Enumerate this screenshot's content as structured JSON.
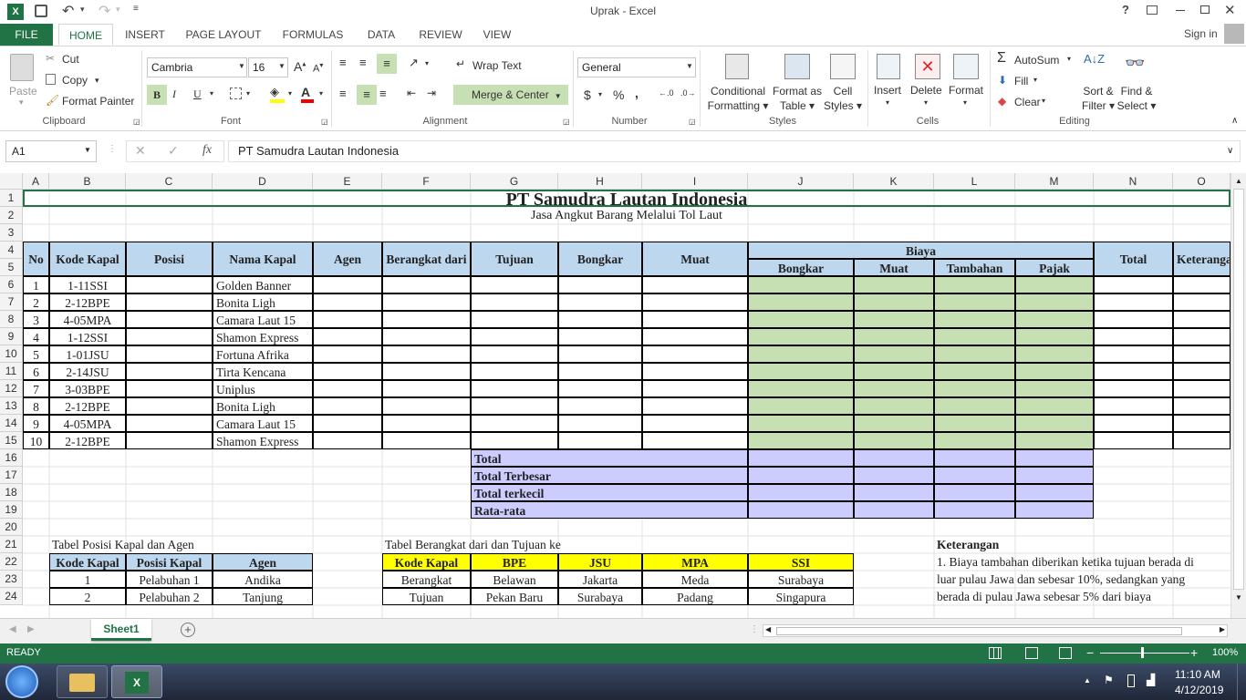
{
  "window": {
    "title": "Uprak - Excel",
    "help": "?",
    "sign_in": "Sign in"
  },
  "tabs": [
    "FILE",
    "HOME",
    "INSERT",
    "PAGE LAYOUT",
    "FORMULAS",
    "DATA",
    "REVIEW",
    "VIEW"
  ],
  "ribbon": {
    "clipboard": {
      "paste": "Paste",
      "cut": "Cut",
      "copy": "Copy",
      "format_painter": "Format Painter",
      "label": "Clipboard"
    },
    "font": {
      "name": "Cambria",
      "size": "16",
      "label": "Font",
      "bold": "B",
      "italic": "I",
      "underline": "U"
    },
    "alignment": {
      "wrap": "Wrap Text",
      "merge": "Merge & Center",
      "label": "Alignment"
    },
    "number": {
      "format": "General",
      "currency": "$",
      "percent": "%",
      "comma": ",",
      "label": "Number"
    },
    "styles": {
      "conditional": "Conditional",
      "conditional2": "Formatting",
      "format_as": "Format as",
      "format_as2": "Table",
      "cell": "Cell",
      "cell2": "Styles",
      "label": "Styles"
    },
    "cells": {
      "insert": "Insert",
      "delete": "Delete",
      "format": "Format",
      "label": "Cells"
    },
    "editing": {
      "autosum": "AutoSum",
      "fill": "Fill",
      "clear": "Clear",
      "sort": "Sort &",
      "sort2": "Filter",
      "find": "Find &",
      "find2": "Select",
      "label": "Editing"
    }
  },
  "formula_bar": {
    "name_box": "A1",
    "fx": "fx",
    "content": "PT Samudra Lautan Indonesia"
  },
  "columns": [
    "A",
    "B",
    "C",
    "D",
    "E",
    "F",
    "G",
    "H",
    "I",
    "J",
    "K",
    "L",
    "M",
    "N",
    "O"
  ],
  "rows": [
    "1",
    "2",
    "3",
    "4",
    "5",
    "6",
    "7",
    "8",
    "9",
    "10",
    "11",
    "12",
    "13",
    "14",
    "15",
    "16",
    "17",
    "18",
    "19",
    "20",
    "21",
    "22",
    "23",
    "24"
  ],
  "sheet": {
    "title": "PT Samudra Lautan Indonesia",
    "subtitle": "Jasa Angkut Barang Melalui Tol Laut",
    "headers": {
      "no": "No",
      "kode": "Kode Kapal",
      "posisi": "Posisi",
      "nama": "Nama Kapal",
      "agen": "Agen",
      "berangkat": "Berangkat dari",
      "tujuan": "Tujuan",
      "bongkar": "Bongkar",
      "muat": "Muat",
      "biaya": "Biaya",
      "b_bongkar": "Bongkar",
      "b_muat": "Muat",
      "b_tambahan": "Tambahan",
      "b_pajak": "Pajak",
      "total": "Total",
      "keterangan": "Keterangan"
    },
    "data": [
      {
        "no": "1",
        "kode": "1-11SSI",
        "nama": "Golden Banner"
      },
      {
        "no": "2",
        "kode": "2-12BPE",
        "nama": "Bonita Ligh"
      },
      {
        "no": "3",
        "kode": "4-05MPA",
        "nama": "Camara Laut 15"
      },
      {
        "no": "4",
        "kode": "1-12SSI",
        "nama": "Shamon Express"
      },
      {
        "no": "5",
        "kode": "1-01JSU",
        "nama": "Fortuna Afrika"
      },
      {
        "no": "6",
        "kode": "2-14JSU",
        "nama": "Tirta Kencana"
      },
      {
        "no": "7",
        "kode": "3-03BPE",
        "nama": "Uniplus"
      },
      {
        "no": "8",
        "kode": "2-12BPE",
        "nama": "Bonita Ligh"
      },
      {
        "no": "9",
        "kode": "4-05MPA",
        "nama": "Camara Laut 15"
      },
      {
        "no": "10",
        "kode": "2-12BPE",
        "nama": "Shamon Express"
      }
    ],
    "summary": [
      "Total",
      "Total Terbesar",
      "Total terkecil",
      "Rata-rata"
    ],
    "table_posisi": {
      "title": "Tabel Posisi Kapal dan Agen",
      "headers": [
        "Kode Kapal",
        "Posisi Kapal",
        "Agen"
      ],
      "rows": [
        [
          "1",
          "Pelabuhan 1",
          "Andika"
        ],
        [
          "2",
          "Pelabuhan 2",
          "Tanjung"
        ]
      ]
    },
    "table_berangkat": {
      "title": "Tabel Berangkat dari dan Tujuan ke",
      "headers": [
        "Kode Kapal",
        "BPE",
        "JSU",
        "MPA",
        "SSI"
      ],
      "rows": [
        [
          "Berangkat",
          "Belawan",
          "Jakarta",
          "Meda",
          "Surabaya"
        ],
        [
          "Tujuan",
          "Pekan Baru",
          "Surabaya",
          "Padang",
          "Singapura"
        ]
      ]
    },
    "keterangan": {
      "title": "Keterangan",
      "lines": [
        "1. Biaya tambahan diberikan ketika tujuan berada di",
        "luar pulau Jawa dan sebesar 10%, sedangkan yang",
        "berada di pulau Jawa sebesar 5% dari biaya"
      ]
    }
  },
  "sheet_tab": "Sheet1",
  "status": {
    "ready": "READY",
    "zoom": "100%"
  },
  "taskbar": {
    "time": "11:10 AM",
    "date": "4/12/2019"
  },
  "colors": {
    "excel_green": "#217346",
    "header_blue": "#bdd7ee",
    "green_fill": "#c6e0b4",
    "lavender": "#ccccff",
    "yellow": "#ffff00"
  }
}
